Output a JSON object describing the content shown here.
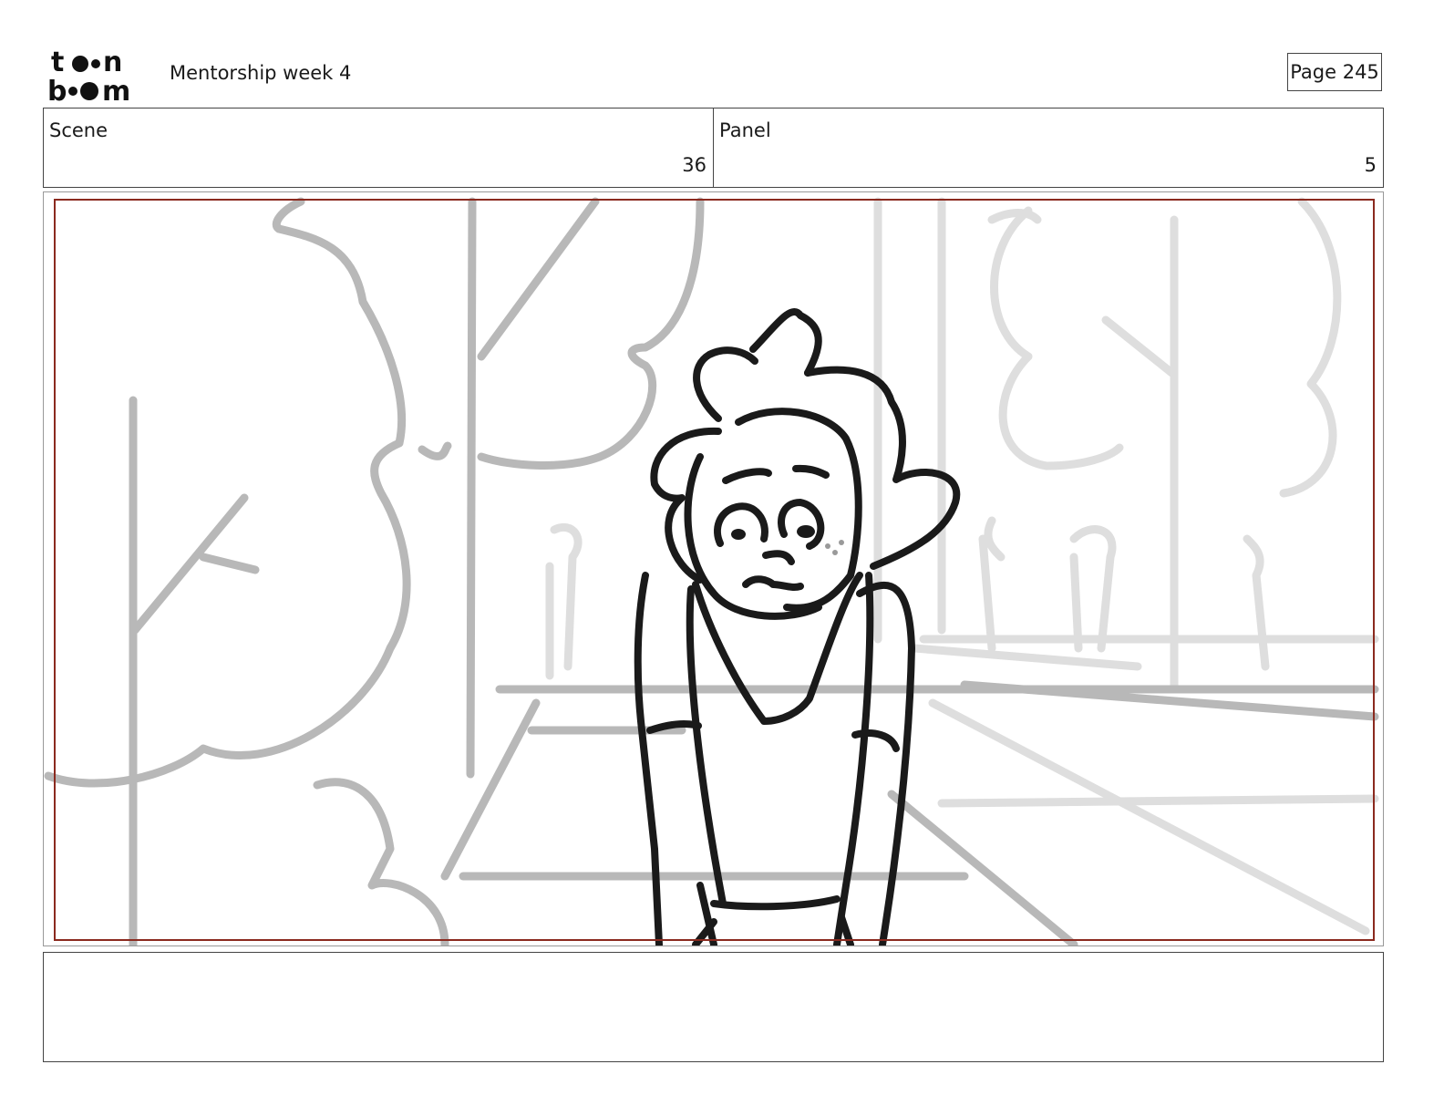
{
  "header": {
    "logo_text_top": "toon",
    "logo_text_bottom": "boom",
    "title": "Mentorship week 4",
    "page_label": "Page 245"
  },
  "info": {
    "scene_label": "Scene",
    "scene_value": "36",
    "panel_label": "Panel",
    "panel_value": "5"
  },
  "notes": {
    "text": ""
  },
  "colors": {
    "safe_frame": "#8b2a1f",
    "ink": "#1a1a1a",
    "background_sketch": "#b8b8b8",
    "background_sketch_faint": "#dcdcdc"
  }
}
